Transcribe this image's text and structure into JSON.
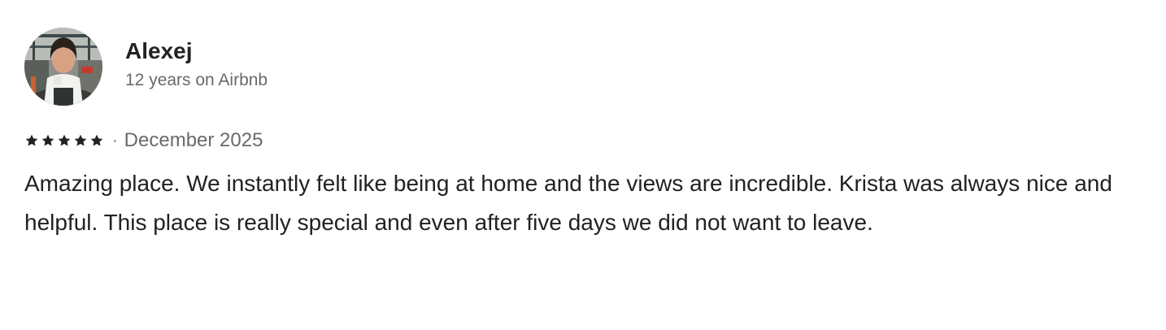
{
  "reviewer": {
    "name": "Alexej",
    "tenure": "12 years on Airbnb",
    "avatar_icon": "avatar-photo"
  },
  "review": {
    "rating": 5,
    "rating_max": 5,
    "separator": "·",
    "date": "December 2025",
    "text": "Amazing place. We instantly felt like being at home and the views are incredible. Krista was always nice and helpful. This place is really special and even after five days we did not want to leave."
  },
  "colors": {
    "text_primary": "#222222",
    "text_secondary": "#6a6a6a",
    "star": "#222222",
    "background": "#ffffff"
  }
}
